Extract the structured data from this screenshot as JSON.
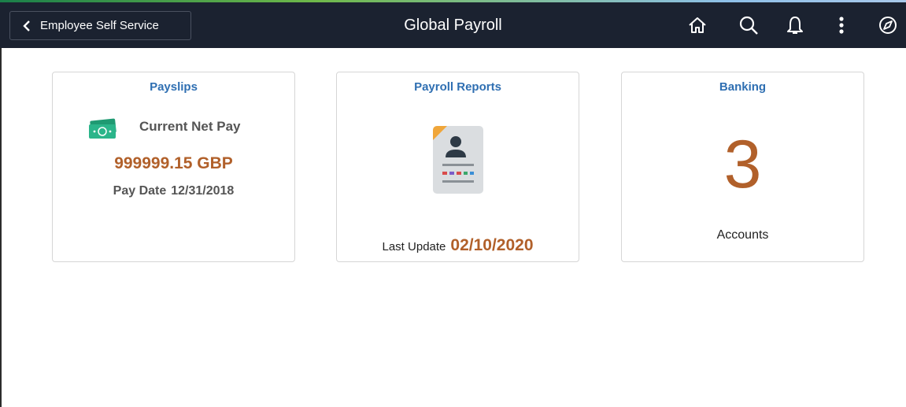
{
  "header": {
    "back_label": "Employee Self Service",
    "title": "Global Payroll",
    "icons": [
      "home-icon",
      "search-icon",
      "bell-icon",
      "more-vertical-icon",
      "compass-icon"
    ]
  },
  "tiles": {
    "payslips": {
      "title": "Payslips",
      "net_pay_label": "Current Net Pay",
      "net_pay_amount": "999999.15 GBP",
      "pay_date_label": "Pay Date",
      "pay_date_value": "12/31/2018",
      "icon": "money-icon"
    },
    "payroll_reports": {
      "title": "Payroll Reports",
      "last_update_label": "Last Update",
      "last_update_value": "02/10/2020",
      "icon": "report-document-icon"
    },
    "banking": {
      "title": "Banking",
      "count": "3",
      "count_label": "Accounts"
    }
  },
  "colors": {
    "header_bg": "#1b2230",
    "tile_title": "#2f6fb2",
    "highlight_value": "#b1602a",
    "money_icon": "#2bb58a"
  }
}
